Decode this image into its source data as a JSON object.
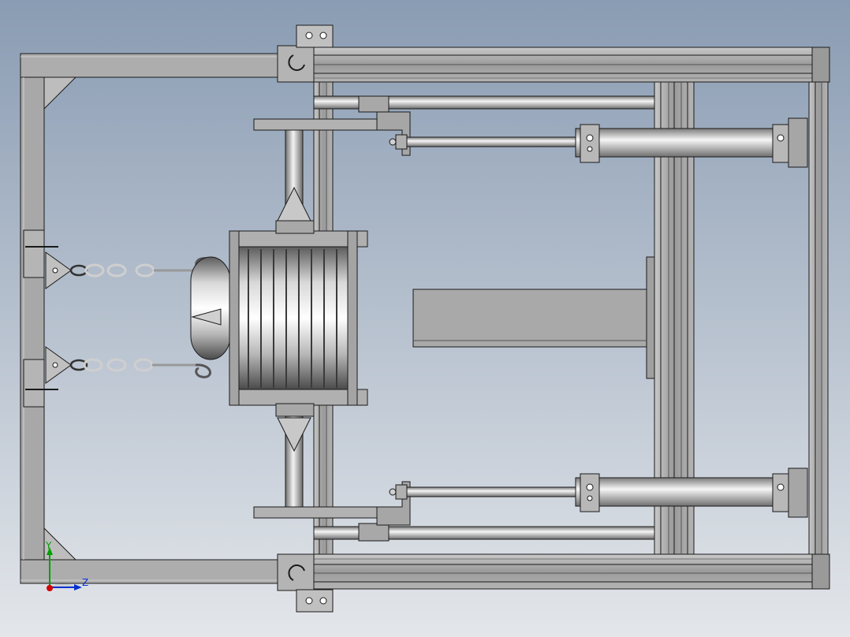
{
  "viewport": {
    "background_top": "#8a9cb3",
    "background_bottom": "#e3e6ea"
  },
  "colors": {
    "frame_fill": "#aaaaaa",
    "frame_dark": "#8c8c8c",
    "frame_light": "#c4c4c4",
    "outline": "#1a1a1a",
    "metal_light": "#f2f2f2",
    "metal_dark": "#7a7a7a",
    "triad_x": "#d40000",
    "triad_y": "#00a000",
    "triad_z": "#0030d0"
  },
  "triad": {
    "y_label": "Y",
    "z_label": "Z"
  },
  "parts": {
    "left_frame": "welded-square-tube-frame",
    "right_frame": "aluminum-extrusion-frame",
    "drum": "ribbed-cylinder",
    "cylinders": "pneumatic-cylinder",
    "chains": "lifting-chain-with-hook",
    "plate": "rectangular-pad"
  }
}
